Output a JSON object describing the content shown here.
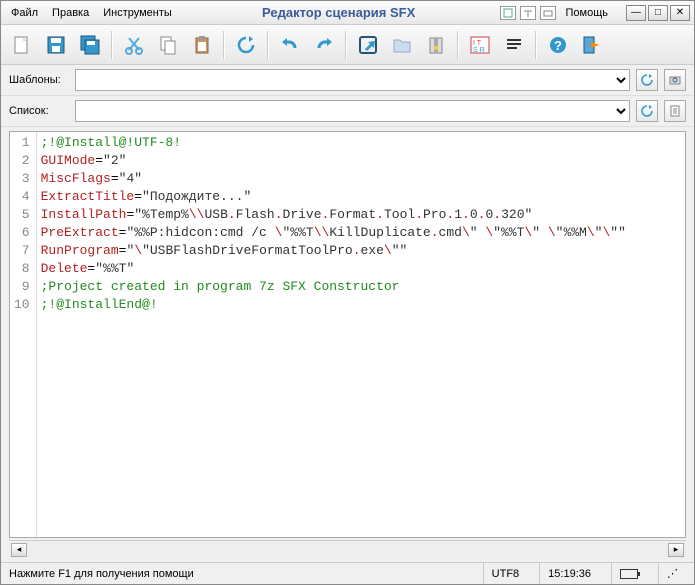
{
  "menu": {
    "file": "Файл",
    "edit": "Правка",
    "tools": "Инструменты",
    "help": "Помощь"
  },
  "window": {
    "title": "Редактор сценария SFX"
  },
  "rows": {
    "templates_label": "Шаблоны:",
    "list_label": "Список:"
  },
  "code": {
    "lines": [
      {
        "n": "1",
        "type": "comment",
        "text": ";!@Install@!UTF-8!"
      },
      {
        "n": "2",
        "type": "kv",
        "key": "GUIMode",
        "val": "\"2\""
      },
      {
        "n": "3",
        "type": "kv",
        "key": "MiscFlags",
        "val": "\"4\""
      },
      {
        "n": "4",
        "type": "kv",
        "key": "ExtractTitle",
        "val": "\"Подождите...\""
      },
      {
        "n": "5",
        "type": "kv",
        "key": "InstallPath",
        "val": "\"%Temp%\\\\USB.Flash.Drive.Format.Tool.Pro.1.0.0.320\""
      },
      {
        "n": "6",
        "type": "kv",
        "key": "PreExtract",
        "val": "\"%%P:hidcon:cmd /c \\\"%%T\\\\KillDuplicate.cmd\\\" \\\"%%T\\\" \\\"%%M\\\"\\\"\""
      },
      {
        "n": "7",
        "type": "kv",
        "key": "RunProgram",
        "val": "\"\\\"USBFlashDriveFormatToolPro.exe\\\"\""
      },
      {
        "n": "8",
        "type": "kv",
        "key": "Delete",
        "val": "\"%%T\""
      },
      {
        "n": "9",
        "type": "comment",
        "text": ";Project created in program 7z SFX Constructor"
      },
      {
        "n": "10",
        "type": "comment",
        "text": ";!@InstallEnd@!"
      }
    ]
  },
  "status": {
    "hint": "Нажмите F1 для получения помощи",
    "encoding": "UTF8",
    "time": "15:19:36"
  }
}
